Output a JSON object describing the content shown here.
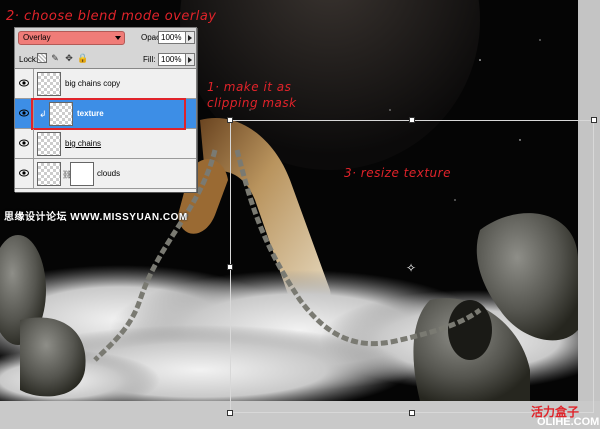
{
  "annotations": {
    "step2": "2· choose blend mode overlay",
    "step1_line1": "1· make it as",
    "step1_line2": "clipping mask",
    "step3": "3· resize texture"
  },
  "layers_panel": {
    "blend_mode": "Overlay",
    "opacity_label": "Opacity:",
    "opacity_value": "100%",
    "lock_label": "Lock:",
    "fill_label": "Fill:",
    "fill_value": "100%",
    "layers": [
      {
        "name": "big chains copy",
        "visible": true,
        "selected": false
      },
      {
        "name": "texture",
        "visible": true,
        "selected": true,
        "clipping_mask": true
      },
      {
        "name": "big chains",
        "visible": true,
        "selected": false
      },
      {
        "name": "clouds",
        "visible": true,
        "selected": false,
        "has_mask": true
      }
    ]
  },
  "watermarks": {
    "left": "思缘设计论坛 WWW.MISSYUAN.COM",
    "bottom_right_cn": "活力盒子",
    "bottom_right_en": "OLIHE.COM"
  },
  "colors": {
    "annotation": "#e0232a",
    "selected_layer": "#3d8ee6",
    "blend_field": "#f07c78"
  }
}
